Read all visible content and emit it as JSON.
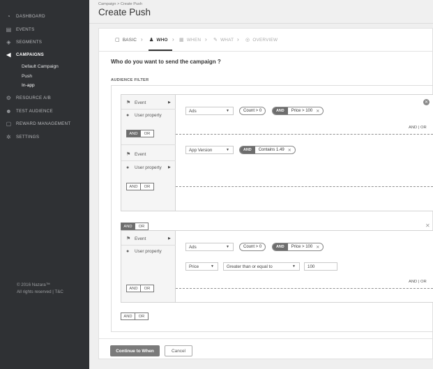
{
  "sidebar": {
    "items": [
      {
        "label": "DASHBOARD",
        "icon": "dashboard-icon"
      },
      {
        "label": "EVENTS",
        "icon": "events-icon"
      },
      {
        "label": "SEGMENTS",
        "icon": "segments-icon"
      },
      {
        "label": "CAMPAIGNS",
        "icon": "campaigns-icon"
      },
      {
        "label": "RESOURCE A/B",
        "icon": "resource-icon"
      },
      {
        "label": "TEST AUDIENCE",
        "icon": "test-audience-icon"
      },
      {
        "label": "REWARD MANAGEMENT",
        "icon": "reward-icon"
      },
      {
        "label": "SETTINGS",
        "icon": "settings-icon"
      }
    ],
    "sub_items": [
      "Default Campaign",
      "Push",
      "In-app"
    ],
    "copyright_line1": "© 2016 Nazara™",
    "copyright_line2": "All rights reserved | T&C"
  },
  "header": {
    "breadcrumb": "Campaign > Create Push",
    "title": "Create Push"
  },
  "steps": [
    "BASIC",
    "WHO",
    "WHEN",
    "WHAT",
    "OVERVIEW"
  ],
  "question": "Who do you want to send the campaign ?",
  "audience_label": "AUDIENCE FILTER",
  "type_labels": {
    "event": "Event",
    "user_property": "User property"
  },
  "andor": {
    "and": "AND",
    "or": "OR",
    "text": "AND  |  OR"
  },
  "group1": {
    "cond1": {
      "select": "Ads",
      "count": "Count > 0",
      "and_label": "AND",
      "pill": "Price > 100"
    },
    "cond2": {
      "select": "App Version",
      "and_label": "AND",
      "pill": "Contains 1.49"
    }
  },
  "group2": {
    "cond1": {
      "select": "Ads",
      "count": "Count > 0",
      "and_label": "AND",
      "pill": "Price > 100"
    },
    "cond2": {
      "select": "Price",
      "operator": "Greater than or equal to",
      "value": "100"
    }
  },
  "buttons": {
    "continue": "Continue to When",
    "cancel": "Cancel"
  }
}
